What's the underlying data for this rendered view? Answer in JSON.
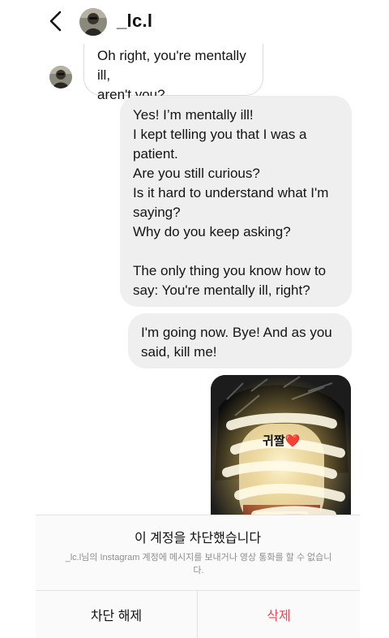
{
  "header": {
    "username": "_lc.l",
    "back_icon": "chevron-left-icon",
    "avatar_icon": "profile-avatar"
  },
  "messages": [
    {
      "direction": "incoming",
      "text": "Oh right, you're mentally ill,\naren't you?"
    },
    {
      "direction": "outgoing",
      "text": "Yes! I’m mentally ill!\nI kept telling you that I was a patient.\nAre you still curious?\nIs it hard to understand what I'm saying?\nWhy do you keep asking?\n\nThe only thing you know how to say: You're mentally ill, right?"
    },
    {
      "direction": "outgoing",
      "text": "I'm going now. Bye! And as you said, kill me!"
    },
    {
      "direction": "outgoing",
      "type": "photo",
      "caption": "귀짤❤️"
    }
  ],
  "block_sheet": {
    "title": "이 계정을 차단했습니다",
    "description": "_lc.l님의 Instagram 계정에 메시지를 보내거나 영상 통화를 할 수 없습니다.",
    "unblock_label": "차단 해제",
    "delete_label": "삭제"
  },
  "colors": {
    "outgoing_bubble": "#efefef",
    "incoming_border": "#dcdcdc",
    "delete_red": "#ed4956",
    "secondary_text": "#8e8e8e"
  }
}
